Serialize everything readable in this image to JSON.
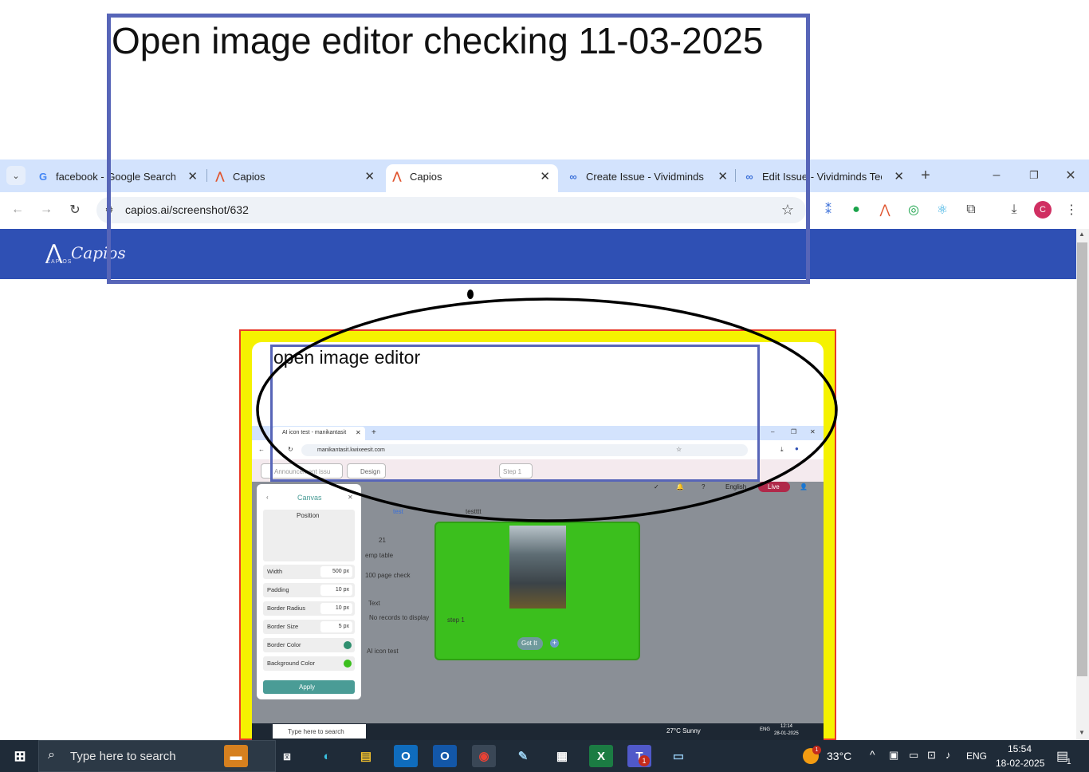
{
  "annotation": {
    "title": "Open image editor checking 11-03-2025",
    "inner_title": "open image editor"
  },
  "browser": {
    "tabs": [
      {
        "label": "facebook - Google Search",
        "icon": "google-icon"
      },
      {
        "label": "Capios",
        "icon": "capios-icon"
      },
      {
        "label": "Capios",
        "icon": "capios-icon",
        "active": true
      },
      {
        "label": "Create Issue - Vividminds Te",
        "icon": "vividminds-icon"
      },
      {
        "label": "Edit Issue - Vividminds Techn",
        "icon": "vividminds-icon"
      }
    ],
    "new_tab": "+",
    "url": "capios.ai/screenshot/632",
    "profile_initial": "C"
  },
  "site": {
    "logo_text": "Capios",
    "logo_sub": "CAPIOS"
  },
  "inner_screenshot": {
    "tab_label": "AI icon test - manikantasit",
    "url": "manikantasit.kwixeesit.com",
    "app_buttons": {
      "back_label": "Announcement issu",
      "design_label": "Design",
      "step_label": "Step 1"
    },
    "nav_right": {
      "language": "English",
      "live": "Live"
    },
    "panel": {
      "title": "Canvas",
      "section": "Position",
      "rows": [
        {
          "label": "Width",
          "value": "500 px"
        },
        {
          "label": "Padding",
          "value": "10 px"
        },
        {
          "label": "Border Radius",
          "value": "10 px"
        },
        {
          "label": "Border Size",
          "value": "5 px"
        },
        {
          "label": "Border Color",
          "value": ""
        },
        {
          "label": "Background Color",
          "value": ""
        }
      ],
      "apply_label": "Apply"
    },
    "background_items": {
      "tab_a": "test",
      "tab_b": "testttt",
      "number": "21",
      "emp_table": "emp table",
      "page_check": "100 page check",
      "text_col": "Text",
      "no_records": "No records to display",
      "ai_icon_test": "AI icon test"
    },
    "modal": {
      "step_text": "step 1",
      "button_label": "Got It"
    },
    "taskbar": {
      "search": "Type here to search",
      "weather": "27°C  Sunny",
      "lang": "ENG",
      "time": "12:14",
      "date": "28-01-2025"
    }
  },
  "taskbar": {
    "search_placeholder": "Type here to search",
    "weather": "33°C",
    "weather_badge": "1",
    "language": "ENG",
    "time": "15:54",
    "date": "18-02-2025",
    "notification_count": "1",
    "teams_badge": "1"
  },
  "colors": {
    "tabstrip": "#d3e3fd",
    "site_header": "#2f50b4",
    "annotation_box": "#5765b8",
    "frame_yellow": "#f5f200",
    "frame_border_red": "#e83a2a",
    "modal_green": "#3bbf1d",
    "taskbar": "#1f2b38"
  }
}
